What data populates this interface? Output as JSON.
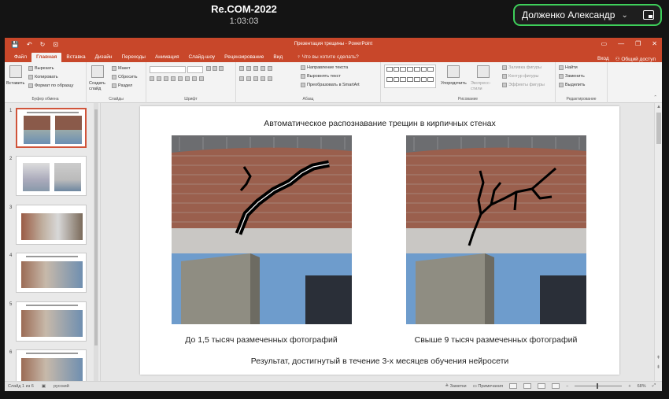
{
  "meeting": {
    "title": "Re.COM-2022",
    "time": "1:03:03",
    "speaker": "Долженко Александр"
  },
  "window": {
    "doc_title": "Презентация трещины - PowerPoint",
    "quick_access": [
      "💾",
      "↶",
      "↻",
      "⊡"
    ],
    "win_buttons": [
      "▭",
      "—",
      "❐",
      "✕"
    ]
  },
  "tabs": [
    {
      "label": "Файл"
    },
    {
      "label": "Главная"
    },
    {
      "label": "Вставка"
    },
    {
      "label": "Дизайн"
    },
    {
      "label": "Переходы"
    },
    {
      "label": "Анимация"
    },
    {
      "label": "Слайд-шоу"
    },
    {
      "label": "Рецензирование"
    },
    {
      "label": "Вид"
    }
  ],
  "tell_me": "Что вы хотите сделать?",
  "tabs_right": {
    "signin": "Вход",
    "share": "Общий доступ"
  },
  "ribbon": {
    "paste": "Вставить",
    "cut": "Вырезать",
    "copy": "Копировать",
    "format_painter": "Формат по образцу",
    "clipboard_group": "Буфер обмена",
    "new_slide": "Создать слайд",
    "layout": "Макет",
    "reset": "Сбросить",
    "section": "Раздел",
    "slides_group": "Слайды",
    "font_group": "Шрифт",
    "text_direction": "Направление текста",
    "align_text": "Выровнять текст",
    "smartart": "Преобразовать в SmartArt",
    "paragraph_group": "Абзац",
    "arrange": "Упорядочить",
    "quick_styles": "Экспресс-стили",
    "shape_fill": "Заливка фигуры",
    "shape_outline": "Контур фигуры",
    "shape_effects": "Эффекты фигуры",
    "drawing_group": "Рисование",
    "find": "Найти",
    "replace": "Заменить",
    "select": "Выделить",
    "editing_group": "Редактирование"
  },
  "thumbnails": [
    {
      "num": "1"
    },
    {
      "num": "2"
    },
    {
      "num": "3"
    },
    {
      "num": "4"
    },
    {
      "num": "5"
    },
    {
      "num": "6"
    }
  ],
  "slide": {
    "title": "Автоматическое распознавание трещин в кирпичных стенах",
    "caption_left": "До 1,5 тысяч размеченных фотографий",
    "caption_right": "Свыше 9 тысяч размеченных фотографий",
    "footer": "Результат, достигнутый в течение 3-х месяцев обучения нейросети"
  },
  "status": {
    "slide_of": "Слайд 1 из 6",
    "language": "русский",
    "notes": "Заметки",
    "comments": "Примечания",
    "zoom": "68%"
  }
}
